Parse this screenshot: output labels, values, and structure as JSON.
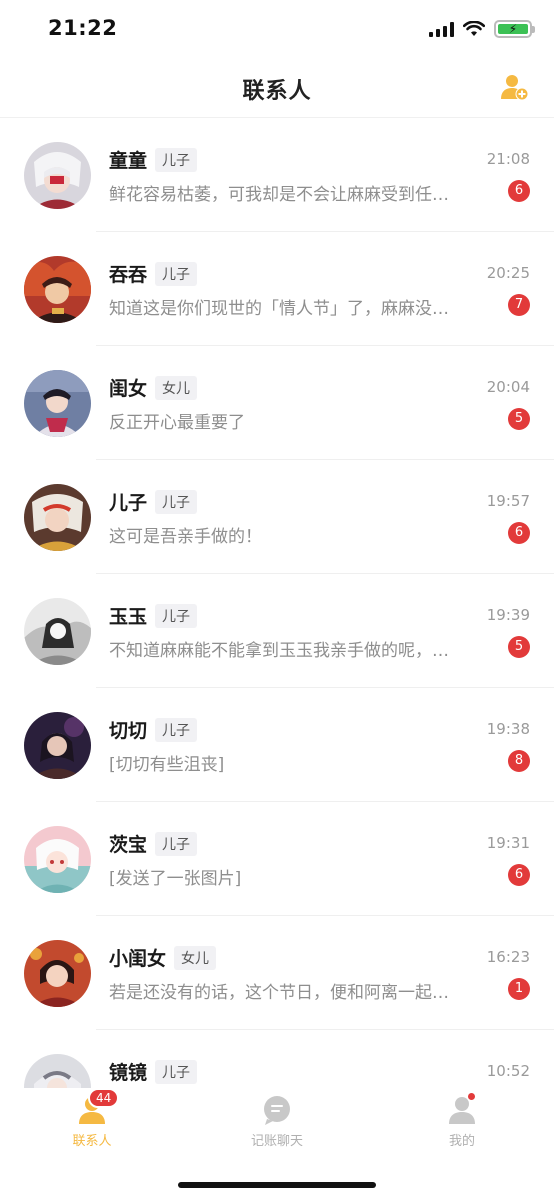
{
  "status_bar": {
    "time": "21:22"
  },
  "nav": {
    "title": "联系人",
    "add_icon": "add-user-icon"
  },
  "colors": {
    "accent": "#f5b942",
    "badge": "#e23a3a",
    "tab_inactive": "#c8c8c8"
  },
  "contacts": [
    {
      "name": "童童",
      "tag": "儿子",
      "time": "21:08",
      "preview": "鲜花容易枯萎，可我却是不会让麻麻受到任何伤害的",
      "unread": "6"
    },
    {
      "name": "吞吞",
      "tag": "儿子",
      "time": "20:25",
      "preview": "知道这是你们现世的「情人节」了，麻麻没有收到吗",
      "unread": "7"
    },
    {
      "name": "闺女",
      "tag": "女儿",
      "time": "20:04",
      "preview": "反正开心最重要了",
      "unread": "5"
    },
    {
      "name": "儿子",
      "tag": "儿子",
      "time": "19:57",
      "preview": "这可是吾亲手做的！",
      "unread": "6"
    },
    {
      "name": "玉玉",
      "tag": "儿子",
      "time": "19:39",
      "preview": "不知道麻麻能不能拿到玉玉我亲手做的呢，麻麻",
      "unread": "5"
    },
    {
      "name": "切切",
      "tag": "儿子",
      "time": "19:38",
      "preview": "[切切有些沮丧]",
      "unread": "8"
    },
    {
      "name": "茨宝",
      "tag": "儿子",
      "time": "19:31",
      "preview": "[发送了一张图片]",
      "unread": "6"
    },
    {
      "name": "小闺女",
      "tag": "女儿",
      "time": "16:23",
      "preview": "若是还没有的话，这个节日，便和阿离一起过吧",
      "unread": "1"
    },
    {
      "name": "镜镜",
      "tag": "儿子",
      "time": "10:52",
      "preview": "",
      "unread": ""
    }
  ],
  "tabs": [
    {
      "label": "联系人",
      "icon": "contacts-icon",
      "badge": "44",
      "active": true
    },
    {
      "label": "记账聊天",
      "icon": "chat-bubble-icon",
      "active": false
    },
    {
      "label": "我的",
      "icon": "profile-icon",
      "dot": true,
      "active": false
    }
  ]
}
